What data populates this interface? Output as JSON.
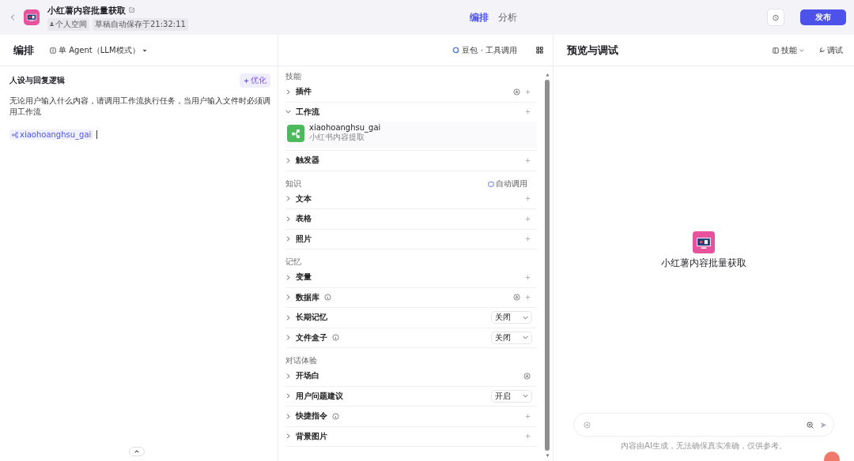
{
  "header": {
    "title": "小红薯内容批量获取",
    "tags": [
      "个人空间",
      "草稿自动保存于21:32:11"
    ],
    "tabs": [
      {
        "label": "编排",
        "selected": true
      },
      {
        "label": "分析",
        "selected": false
      }
    ],
    "publish": "发布"
  },
  "left": {
    "title": "编排",
    "mode": "单 Agent（LLM模式）",
    "prompt_title": "人设与回复逻辑",
    "optimize": "优化",
    "prompt_text": "无论用户输入什么内容，请调用工作流执行任务，当用户输入文件时必须调用工作流",
    "chip": "xiaohoanghsu_gai"
  },
  "middle": {
    "model": "豆包 · 工具调用",
    "sections": [
      {
        "title": "技能",
        "items": [
          {
            "label": "插件",
            "kind": "auto_add",
            "info": false,
            "expanded": false
          },
          {
            "label": "工作流",
            "kind": "add",
            "info": false,
            "expanded": true,
            "children": [
              {
                "name": "xiaohoanghsu_gai",
                "description": "小红书内容提取"
              }
            ]
          },
          {
            "label": "触发器",
            "kind": "add",
            "info": false,
            "expanded": false
          }
        ]
      },
      {
        "title": "知识",
        "extra": "自动调用",
        "items": [
          {
            "label": "文本",
            "kind": "add",
            "info": false,
            "expanded": false
          },
          {
            "label": "表格",
            "kind": "add",
            "info": false,
            "expanded": false
          },
          {
            "label": "照片",
            "kind": "add",
            "info": false,
            "expanded": false
          }
        ]
      },
      {
        "title": "记忆",
        "items": [
          {
            "label": "变量",
            "kind": "add",
            "info": false,
            "expanded": false
          },
          {
            "label": "数据库",
            "kind": "auto_add",
            "info": true,
            "expanded": false
          },
          {
            "label": "长期记忆",
            "kind": "select",
            "value": "关闭",
            "info": false,
            "expanded": false
          },
          {
            "label": "文件盒子",
            "kind": "select",
            "value": "关闭",
            "info": true,
            "expanded": false
          }
        ]
      },
      {
        "title": "对话体验",
        "items": [
          {
            "label": "开场白",
            "kind": "auto",
            "info": false,
            "expanded": false
          },
          {
            "label": "用户问题建议",
            "kind": "select",
            "value": "开启",
            "info": false,
            "expanded": false
          },
          {
            "label": "快捷指令",
            "kind": "add",
            "info": true,
            "expanded": false
          },
          {
            "label": "背景图片",
            "kind": "add",
            "info": false,
            "expanded": false
          }
        ]
      }
    ]
  },
  "right": {
    "title": "预览与调试",
    "skills": "技能",
    "debug": "调试",
    "bot_name": "小红薯内容批量获取",
    "disclaimer": "内容由AI生成，无法确保真实准确，仅供参考。"
  }
}
